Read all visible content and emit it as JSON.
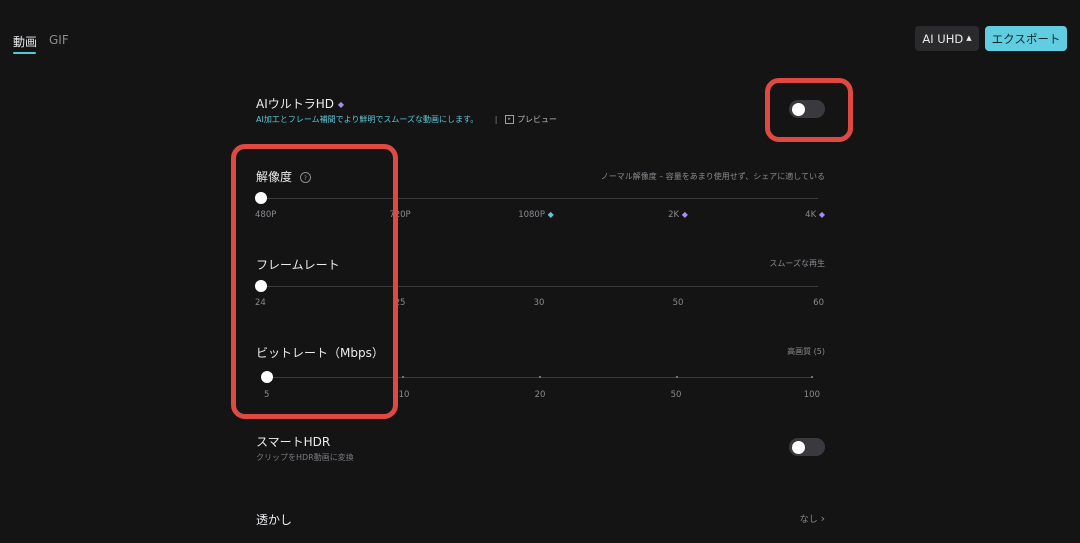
{
  "tabs": {
    "video": "動画",
    "gif": "GIF"
  },
  "header": {
    "ai_uhd": "AI UHD",
    "export": "エクスポート"
  },
  "ai_ultra_hd": {
    "title": "AIウルトラHD",
    "desc": "AI加工とフレーム補間でより鮮明でスムーズな動画にします。",
    "separator": "|",
    "preview": "プレビュー",
    "enabled": false
  },
  "resolution": {
    "title": "解像度",
    "help": "?",
    "hint": "ノーマル解像度 – 容量をあまり使用せず、シェアに適している",
    "ticks": [
      "480P",
      "720P",
      "1080P",
      "2K",
      "4K"
    ],
    "selected": "480P"
  },
  "frame_rate": {
    "title": "フレームレート",
    "hint": "スムーズな再生",
    "ticks": [
      "24",
      "25",
      "30",
      "50",
      "60"
    ],
    "selected": "24"
  },
  "bitrate": {
    "title": "ビットレート（Mbps）",
    "hint": "高画質 (5)",
    "ticks": [
      "5",
      "10",
      "20",
      "50",
      "100"
    ],
    "selected": "5"
  },
  "smart_hdr": {
    "title": "スマートHDR",
    "desc": "クリップをHDR動画に変換",
    "enabled": false
  },
  "watermark": {
    "title": "透かし",
    "value": "なし",
    "chevron": "›"
  },
  "icons": {
    "premium": "gem-icon",
    "help": "question-circle-icon",
    "preview": "play-box-icon",
    "caret": "caret-up-icon",
    "chevron": "chevron-right-icon"
  },
  "colors": {
    "accent": "#61cde0",
    "highlight": "#e04842",
    "premium": "#a88cf5"
  }
}
